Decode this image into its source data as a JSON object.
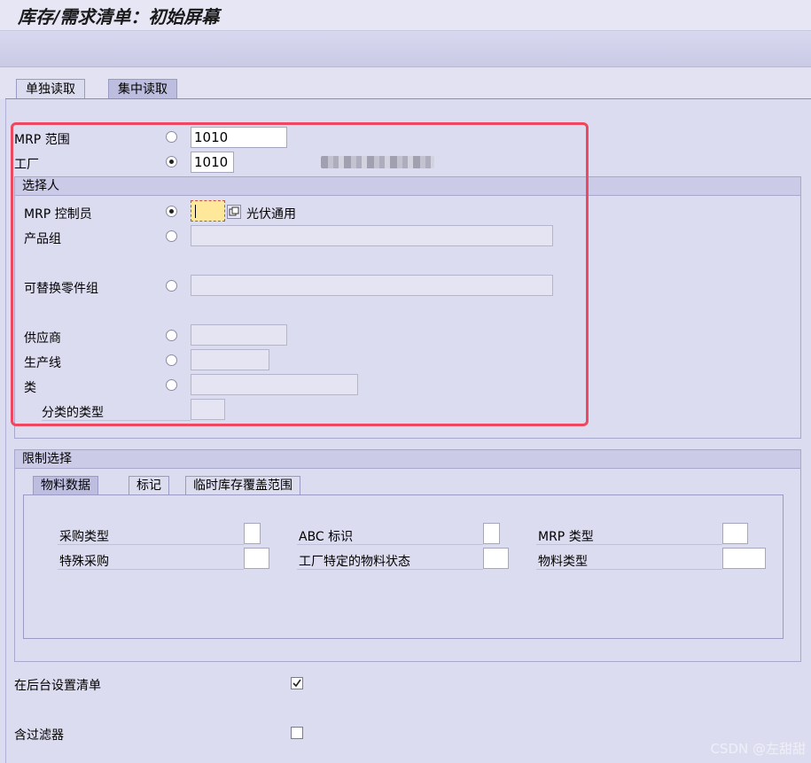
{
  "title": "库存/需求清单：初始屏幕",
  "tabs": [
    "单独读取",
    "集中读取"
  ],
  "mrp_area": {
    "label": "MRP 范围",
    "value": "1010"
  },
  "plant": {
    "label": "工厂",
    "value": "1010"
  },
  "selector_group": {
    "title": "选择人",
    "mrp_controller": {
      "label": "MRP 控制员",
      "value": "",
      "description": "光伏通用"
    },
    "product_group": {
      "label": "产品组"
    },
    "replacement_part_group": {
      "label": "可替换零件组"
    },
    "vendor": {
      "label": "供应商"
    },
    "production_line": {
      "label": "生产线"
    },
    "class": {
      "label": "类"
    },
    "class_type": {
      "label": "分类的类型"
    }
  },
  "restriction_group": {
    "title": "限制选择",
    "subtabs": [
      "物料数据",
      "标记",
      "临时库存覆盖范围"
    ],
    "fields": {
      "procurement_type": "采购类型",
      "abc_indicator": "ABC 标识",
      "mrp_type": "MRP 类型",
      "special_procurement": "特殊采购",
      "plant_specific_status": "工厂特定的物料状态",
      "material_type": "物料类型"
    }
  },
  "background_list": {
    "label": "在后台设置清单",
    "checked": true
  },
  "with_filter": {
    "label": "含过滤器",
    "checked": false
  },
  "watermark": "CSDN @左甜甜",
  "colors": {
    "highlight_box": "#ee4860",
    "focus_field": "#ffe89a"
  }
}
